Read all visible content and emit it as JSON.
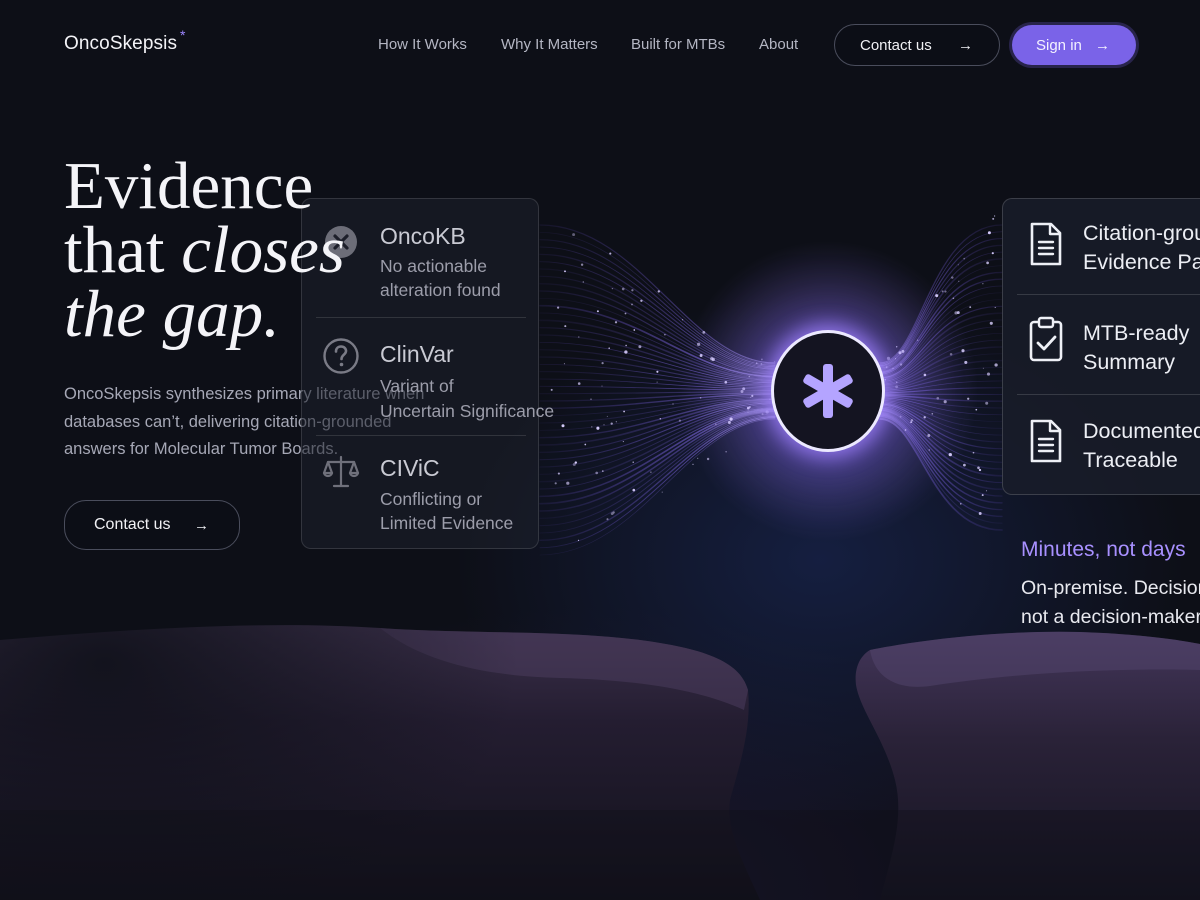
{
  "brand": {
    "name": "OncoSkepsis",
    "mark": "*"
  },
  "nav": {
    "links": [
      "How It Works",
      "Why It Matters",
      "Built for MTBs",
      "About"
    ],
    "contact_label": "Contact us",
    "signin_label": "Sign in",
    "arrow_icon": "arrow-right-icon"
  },
  "hero": {
    "title_line1": "Evidence",
    "title_line2_a": "that ",
    "title_line2_b": "closes",
    "title_line3": "the gap.",
    "subtitle": "OncoSkepsis synthesizes primary literature when databases can’t, delivering citation-grounded answers for Molecular Tumor Boards.",
    "cta_label": "Contact us"
  },
  "databases": [
    {
      "name": "OncoKB",
      "desc_line1": "No actionable",
      "desc_line2": "alteration found",
      "icon": "close-circle-icon"
    },
    {
      "name": "ClinVar",
      "desc_line1": "Variant of",
      "desc_line2": "Uncertain Significance",
      "icon": "question-circle-icon"
    },
    {
      "name": "CIViC",
      "desc_line1": "Conflicting or",
      "desc_line2": "Limited Evidence",
      "icon": "scales-icon"
    }
  ],
  "outputs": [
    {
      "line1": "Citation-grou",
      "line2": "Evidence Pac",
      "icon": "document-icon"
    },
    {
      "line1": "MTB-ready",
      "line2": "Summary",
      "icon": "clipboard-check-icon"
    },
    {
      "line1": "Documented",
      "line2": "Traceable",
      "icon": "document-icon"
    }
  ],
  "tagline": {
    "accent": "Minutes, not days",
    "line1": "On-premise. Decision",
    "line2": "not a decision-maker."
  },
  "colors": {
    "accent": "#7a63e8",
    "accent_text": "#a890ff",
    "background": "#0d0f17"
  }
}
